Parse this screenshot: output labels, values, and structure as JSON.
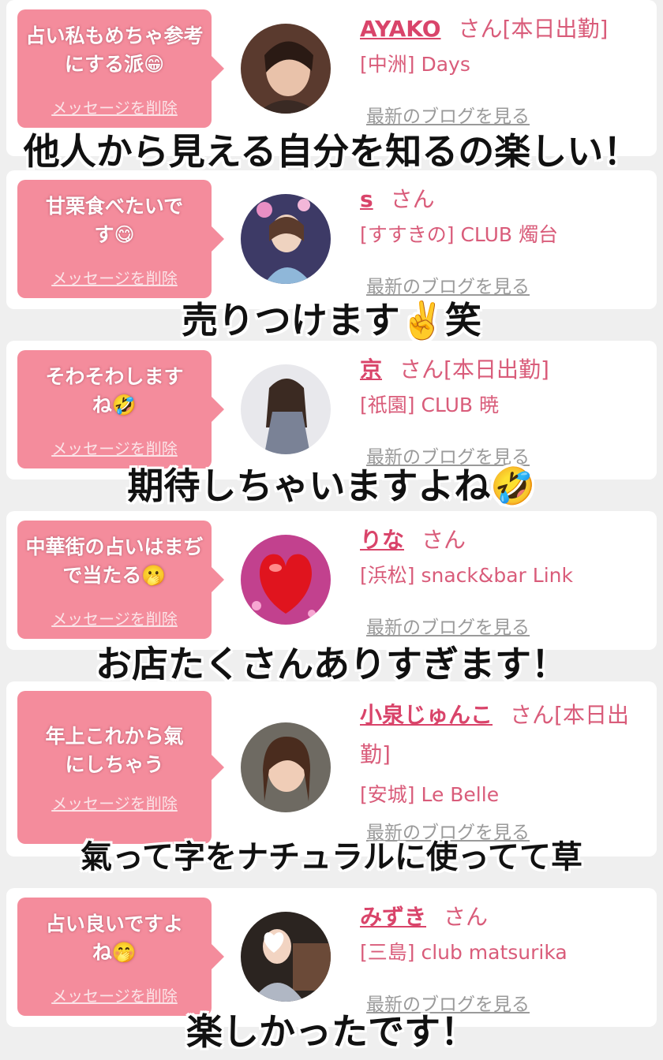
{
  "cards": [
    {
      "message": "占い私もめちゃ参考にする派😁",
      "delete_label": "メッセージを削除",
      "name": "AYAKO",
      "san": "さん",
      "status": "[本日出勤]",
      "shop": "[中洲] Days",
      "blog_label": "最新のブログを見る",
      "avatar": "photo-woman-avatar"
    },
    {
      "message": "甘栗食べたいです😋",
      "delete_label": "メッセージを削除",
      "name": "s",
      "san": "さん",
      "status": "",
      "shop": "[すすきの] CLUB 燭台",
      "blog_label": "最新のブログを見る",
      "avatar": "photo-woman-night-avatar"
    },
    {
      "message": "そわそわしますね🤣",
      "delete_label": "メッセージを削除",
      "name": "京",
      "san": "さん",
      "status": "[本日出勤]",
      "shop": "[祇園] CLUB 暁",
      "blog_label": "最新のブログを見る",
      "avatar": "photo-woman-standing-avatar"
    },
    {
      "message": "中華街の占いはまぢで当たる🫢",
      "delete_label": "メッセージを削除",
      "name": "りな",
      "san": "さん",
      "status": "",
      "shop": "[浜松] snack&bar Link",
      "blog_label": "最新のブログを見る",
      "avatar": "red-heart-avatar"
    },
    {
      "message": "年上これから氣にしちゃう",
      "delete_label": "メッセージを削除",
      "name": "小泉じゅんこ",
      "san": "さん",
      "status": "[本日出勤]",
      "shop": "[安城] Le Belle",
      "blog_label": "最新のブログを見る",
      "avatar": "photo-woman-portrait-avatar"
    },
    {
      "message": "占い良いですよね🤭",
      "delete_label": "メッセージを削除",
      "name": "みずき",
      "san": "さん",
      "status": "",
      "shop": "[三島] club matsurika",
      "blog_label": "最新のブログを見る",
      "avatar": "photo-woman-heart-face-avatar"
    }
  ],
  "captions": [
    "他人から見える自分を知るの楽しい！",
    "売りつけます✌️笑",
    "期待しちゃいますよね🤣",
    "お店たくさんありすぎます！",
    "氣って字をナチュラルに使ってて草",
    "楽しかったです！"
  ],
  "colors": {
    "bubble": "#f48c9c",
    "name": "#d9446a",
    "shop": "#d95c7a",
    "background": "#efefef"
  }
}
